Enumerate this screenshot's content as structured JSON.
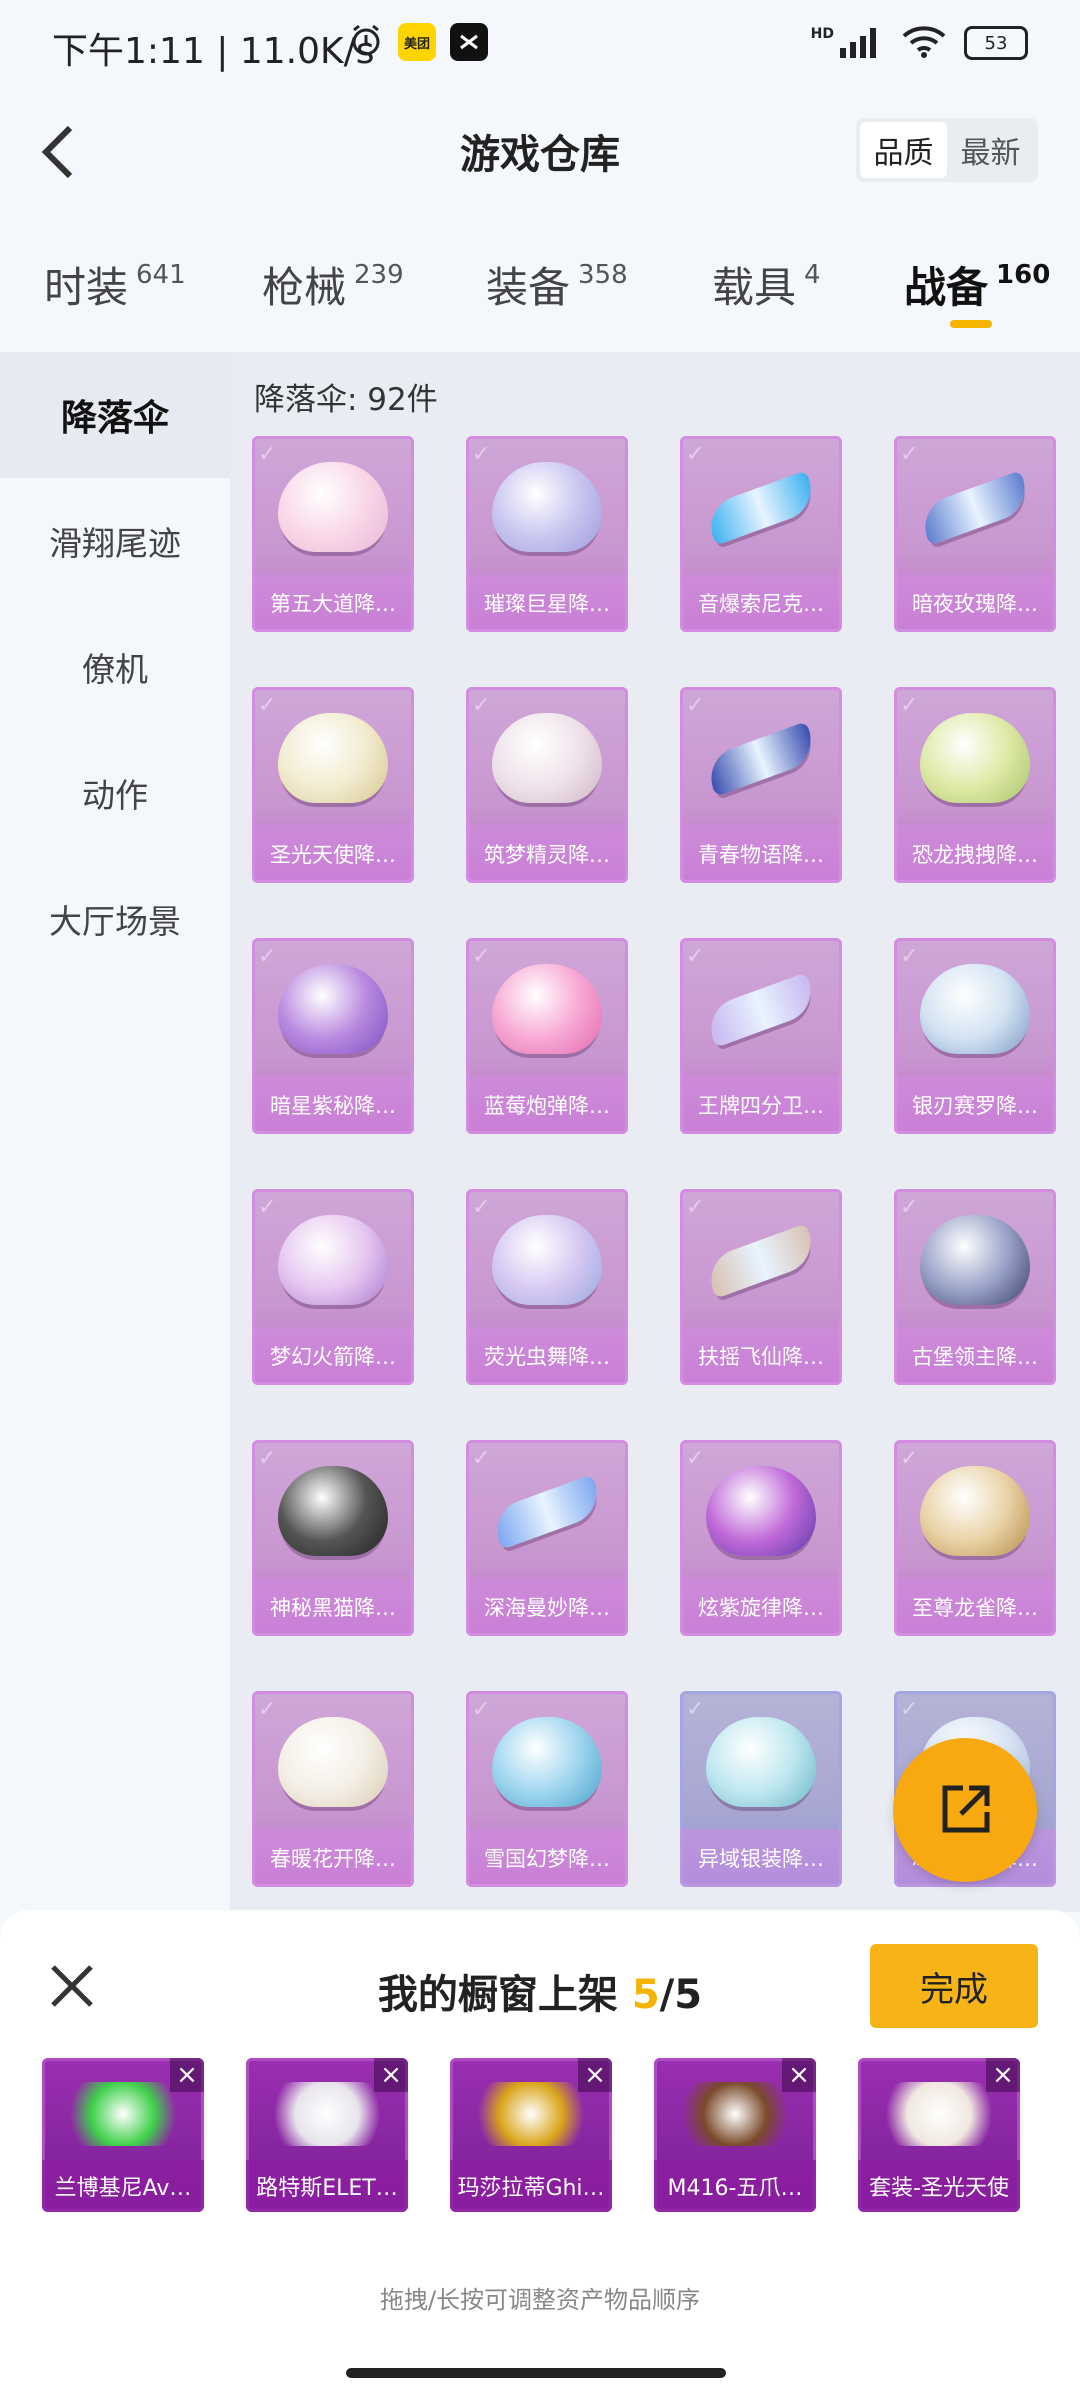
{
  "status_bar": {
    "time_and_speed": "下午1:11 | 11.0K/s",
    "battery": "53",
    "network_badge": "HD",
    "app_badge_1": "美团",
    "icons": [
      "alarm-icon",
      "meituan-app-icon",
      "capcut-app-icon",
      "signal-icon",
      "wifi-icon",
      "battery-icon"
    ]
  },
  "header": {
    "title": "游戏仓库",
    "sort_options": [
      "品质",
      "最新"
    ],
    "active_sort": "品质"
  },
  "tabs": [
    {
      "label": "时装",
      "count": "641"
    },
    {
      "label": "枪械",
      "count": "239"
    },
    {
      "label": "装备",
      "count": "358"
    },
    {
      "label": "载具",
      "count": "4"
    },
    {
      "label": "战备",
      "count": "160",
      "active": true
    }
  ],
  "sidebar": {
    "items": [
      "降落伞",
      "滑翔尾迹",
      "僚机",
      "动作",
      "大厅场景"
    ],
    "active": "降落伞"
  },
  "content": {
    "section_title": "降落伞: 92件",
    "items": [
      "第五大道降…",
      "璀璨巨星降…",
      "音爆索尼克…",
      "暗夜玫瑰降…",
      "圣光天使降…",
      "筑梦精灵降…",
      "青春物语降…",
      "恐龙拽拽降…",
      "暗星紫秘降…",
      "蓝莓炮弹降…",
      "王牌四分卫…",
      "银刃赛罗降…",
      "梦幻火箭降…",
      "荧光虫舞降…",
      "扶摇飞仙降…",
      "古堡领主降…",
      "神秘黑猫降…",
      "深海曼妙降…",
      "炫紫旋律降…",
      "至尊龙雀降…",
      "春暖花开降…",
      "雪国幻梦降…",
      "异域银装降…",
      "冰河战士降…"
    ]
  },
  "sheet": {
    "title_prefix": "我的橱窗上架 ",
    "count_current": "5",
    "count_total": "/5",
    "done_label": "完成",
    "showcase": [
      "兰博基尼Av…",
      "路特斯ELET…",
      "玛莎拉蒂Ghi…",
      "M416-五爪…",
      "套装-圣光天使"
    ],
    "hint": "拖拽/长按可调整资产物品顺序"
  },
  "colors": {
    "accent": "#f7b417",
    "card_purple": "#c896d0",
    "card_blue": "#a8a7d2",
    "showcase_purple": "#8a24a4"
  }
}
